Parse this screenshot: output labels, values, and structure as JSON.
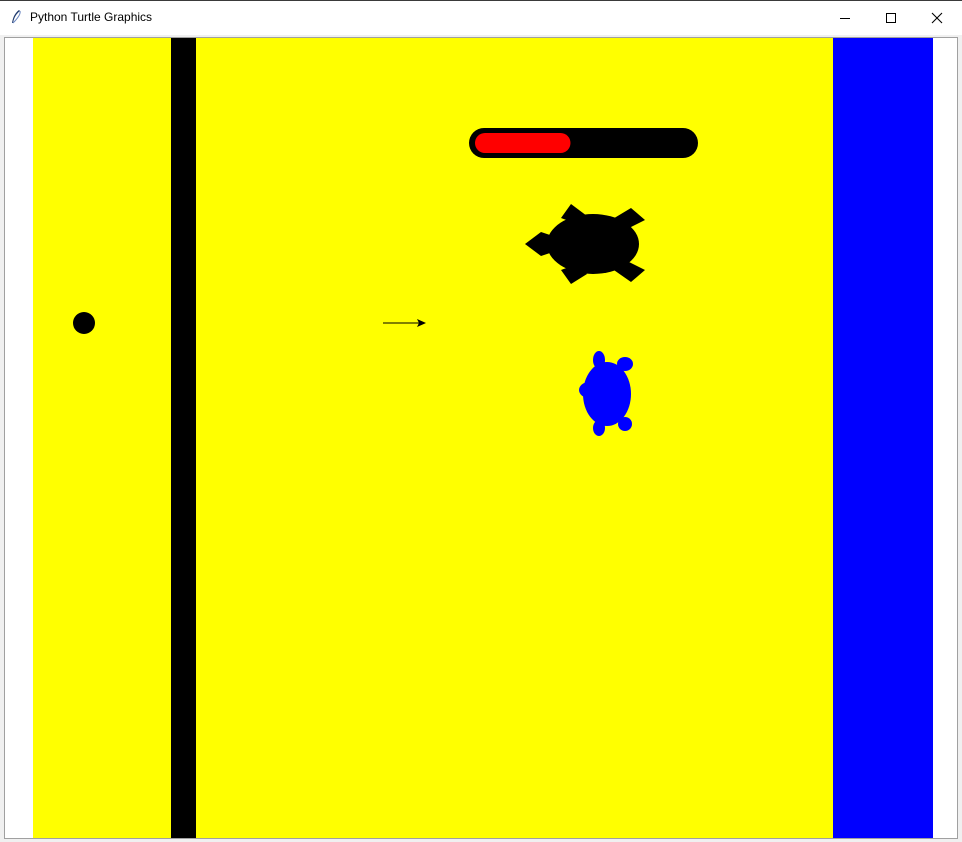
{
  "window": {
    "title": "Python Turtle Graphics",
    "icon": "feather-icon",
    "controls": [
      "minimize-icon",
      "maximize-icon",
      "close-icon"
    ]
  },
  "scene": {
    "background_color": "#ffff00",
    "border_color": "#0000ff",
    "wall_color": "#000000",
    "health_bar": {
      "track_color": "#000000",
      "fill_color": "#ff0000",
      "fill_fraction": 0.44
    },
    "enemy_turtle": {
      "color": "#000000",
      "heading": "left"
    },
    "player_turtle": {
      "color": "#0000ff",
      "heading": "up"
    },
    "ball": {
      "color": "#000000"
    },
    "pointer_arrow": {
      "color": "#000000",
      "heading": "right"
    }
  }
}
